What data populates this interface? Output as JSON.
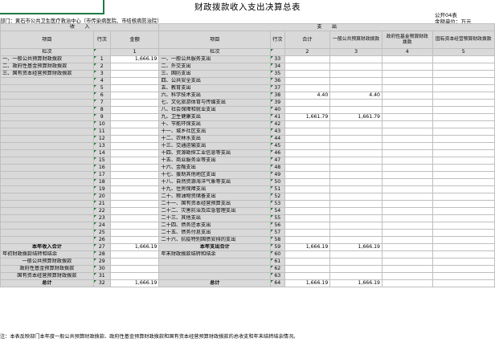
{
  "header": {
    "title": "财政拨款收入支出决算总表",
    "form_no": "公开04表",
    "unit": "金额单位：万元",
    "dept": "部门：黄石市公共卫生医疗救治中心（市传染病医院、市结核病防治院）"
  },
  "columns": {
    "income": "收　　入",
    "expense": "支　　出",
    "item": "项目",
    "line": "行次",
    "amount": "金额",
    "total": "合计",
    "general": "一般公共预算财政拨款",
    "gov_fund": "政府性基金预算财政拨款",
    "state_capital": "国有资本经营预算财政拨款",
    "col_label": "栏次",
    "col_nums": [
      "1",
      "栏次",
      "",
      "2",
      "3",
      "4",
      "5"
    ]
  },
  "rows": [
    {
      "li": "一、一般公共预算财政拨款",
      "ln": "1",
      "la": "1,666.19",
      "ri": "一、一般公共服务支出",
      "rn": "33",
      "t": "",
      "g": ""
    },
    {
      "li": "二、政府性基金预算财政拨款",
      "ln": "2",
      "la": "",
      "ri": "二、外交支出",
      "rn": "34",
      "t": "",
      "g": ""
    },
    {
      "li": "三、国有资本经营预算财政拨款",
      "ln": "3",
      "la": "",
      "ri": "三、国防支出",
      "rn": "35",
      "t": "",
      "g": ""
    },
    {
      "li": "",
      "ln": "4",
      "la": "",
      "ri": "四、公共安全支出",
      "rn": "36",
      "t": "",
      "g": ""
    },
    {
      "li": "",
      "ln": "5",
      "la": "",
      "ri": "五、教育支出",
      "rn": "37",
      "t": "",
      "g": ""
    },
    {
      "li": "",
      "ln": "6",
      "la": "",
      "ri": "六、科学技术支出",
      "rn": "38",
      "t": "4.40",
      "g": "4.40"
    },
    {
      "li": "",
      "ln": "7",
      "la": "",
      "ri": "七、文化旅游体育与传媒支出",
      "rn": "39",
      "t": "",
      "g": ""
    },
    {
      "li": "",
      "ln": "8",
      "la": "",
      "ri": "八、社会保障和就业支出",
      "rn": "40",
      "t": "",
      "g": ""
    },
    {
      "li": "",
      "ln": "9",
      "la": "",
      "ri": "九、卫生健康支出",
      "rn": "41",
      "t": "1,661.79",
      "g": "1,661.79"
    },
    {
      "li": "",
      "ln": "10",
      "la": "",
      "ri": "十、节能环保支出",
      "rn": "42",
      "t": "",
      "g": ""
    },
    {
      "li": "",
      "ln": "11",
      "la": "",
      "ri": "十一、城乡社区支出",
      "rn": "43",
      "t": "",
      "g": ""
    },
    {
      "li": "",
      "ln": "12",
      "la": "",
      "ri": "十二、农林水支出",
      "rn": "44",
      "t": "",
      "g": ""
    },
    {
      "li": "",
      "ln": "13",
      "la": "",
      "ri": "十三、交通运输支出",
      "rn": "45",
      "t": "",
      "g": ""
    },
    {
      "li": "",
      "ln": "14",
      "la": "",
      "ri": "十四、资源勘探工业信息等支出",
      "rn": "46",
      "t": "",
      "g": ""
    },
    {
      "li": "",
      "ln": "15",
      "la": "",
      "ri": "十五、商业服务业等支出",
      "rn": "47",
      "t": "",
      "g": ""
    },
    {
      "li": "",
      "ln": "16",
      "la": "",
      "ri": "十六、金融支出",
      "rn": "48",
      "t": "",
      "g": ""
    },
    {
      "li": "",
      "ln": "17",
      "la": "",
      "ri": "十七、援助其他地区支出",
      "rn": "49",
      "t": "",
      "g": ""
    },
    {
      "li": "",
      "ln": "18",
      "la": "",
      "ri": "十八、自然资源海洋气象等支出",
      "rn": "50",
      "t": "",
      "g": ""
    },
    {
      "li": "",
      "ln": "19",
      "la": "",
      "ri": "十九、住房保障支出",
      "rn": "51",
      "t": "",
      "g": ""
    },
    {
      "li": "",
      "ln": "20",
      "la": "",
      "ri": "二十、粮油物资储备支出",
      "rn": "52",
      "t": "",
      "g": ""
    },
    {
      "li": "",
      "ln": "21",
      "la": "",
      "ri": "二十一、国有资本经营预算支出",
      "rn": "53",
      "t": "",
      "g": ""
    },
    {
      "li": "",
      "ln": "22",
      "la": "",
      "ri": "二十二、灾害防治及应急管理支出",
      "rn": "54",
      "t": "",
      "g": ""
    },
    {
      "li": "",
      "ln": "23",
      "la": "",
      "ri": "二十三、其他支出",
      "rn": "55",
      "t": "",
      "g": ""
    },
    {
      "li": "",
      "ln": "24",
      "la": "",
      "ri": "二十四、债务还本支出",
      "rn": "56",
      "t": "",
      "g": ""
    },
    {
      "li": "",
      "ln": "25",
      "la": "",
      "ri": "二十五、债务付息支出",
      "rn": "57",
      "t": "",
      "g": ""
    },
    {
      "li": "",
      "ln": "26",
      "la": "",
      "ri": "二十六、抗疫特别国债安排的支出",
      "rn": "58",
      "t": "",
      "g": ""
    },
    {
      "li": "本年收入合计",
      "ln": "27",
      "la": "1,666.19",
      "ri": "本年支出合计",
      "rn": "59",
      "t": "1,666.19",
      "g": "1,666.19",
      "bold": true
    },
    {
      "li": "年初财政拨款结转和结余",
      "ln": "28",
      "la": "",
      "ri": "年末财政拨款结转和结余",
      "rn": "60",
      "t": "",
      "g": ""
    },
    {
      "li": "一般公共预算财政拨款",
      "ln": "29",
      "la": "",
      "ri": "",
      "rn": "61",
      "t": "",
      "g": "",
      "indent": true
    },
    {
      "li": "政府性基金预算财政拨款",
      "ln": "30",
      "la": "",
      "ri": "",
      "rn": "62",
      "t": "",
      "g": "",
      "indent": true
    },
    {
      "li": "国有资本经营预算财政拨款",
      "ln": "31",
      "la": "",
      "ri": "",
      "rn": "63",
      "t": "",
      "g": "",
      "indent": true
    },
    {
      "li": "总计",
      "ln": "32",
      "la": "1,666.19",
      "ri": "总计",
      "rn": "64",
      "t": "1,666.19",
      "g": "1,666.19",
      "bold": true
    }
  ],
  "note": "注：本表反映部门本年度一般公共预算财政拨款、政府性基金预算财政拨款和国有资本经营预算财政拨款的总收支和年末结转结余情况。"
}
